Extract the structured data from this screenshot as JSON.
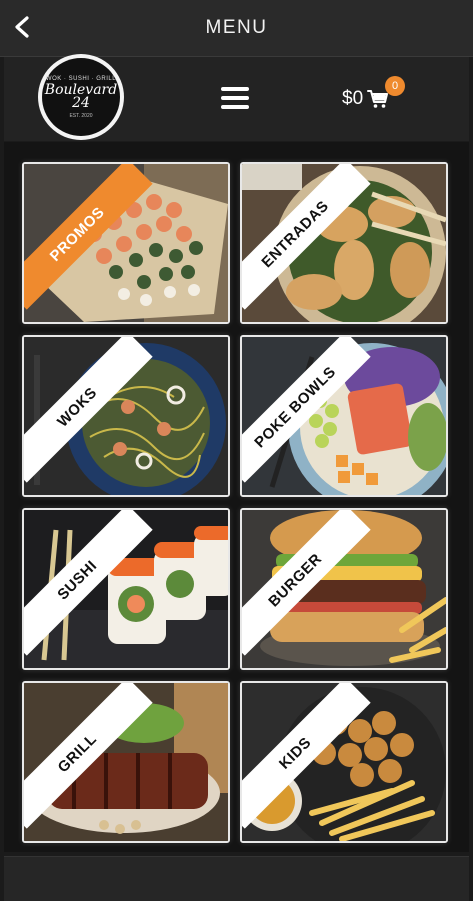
{
  "topbar": {
    "title": "MENU"
  },
  "logo": {
    "top_text": "WOK · SUSHI · GRILL",
    "main_text": "Boulevard 24",
    "est_text": "EST. 2020"
  },
  "cart": {
    "total": "$0",
    "badge_count": "0",
    "accent": "#ef8a2e"
  },
  "categories": [
    {
      "label": "PROMOS",
      "ribbon_color": "#ef8a2e"
    },
    {
      "label": "ENTRADAS",
      "ribbon_color": "#ffffff"
    },
    {
      "label": "WOKS",
      "ribbon_color": "#ffffff"
    },
    {
      "label": "POKE BOWLS",
      "ribbon_color": "#ffffff"
    },
    {
      "label": "SUSHI",
      "ribbon_color": "#ffffff"
    },
    {
      "label": "BURGER",
      "ribbon_color": "#ffffff"
    },
    {
      "label": "GRILL",
      "ribbon_color": "#ffffff"
    },
    {
      "label": "KIDS",
      "ribbon_color": "#ffffff"
    }
  ]
}
